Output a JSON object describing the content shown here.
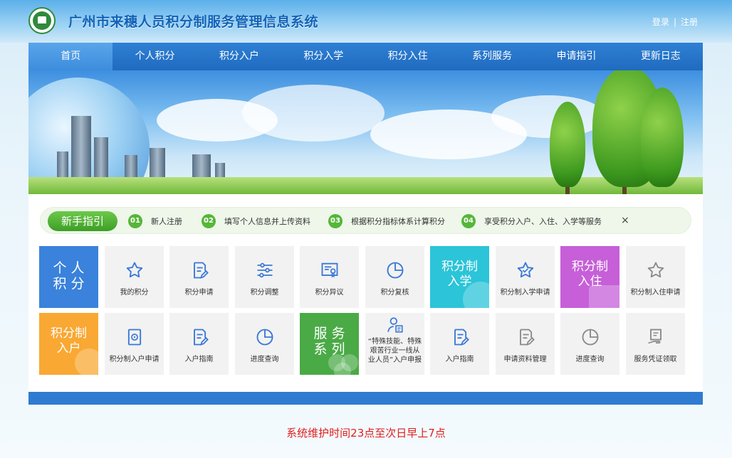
{
  "header": {
    "title": "广州市来穗人员积分制服务管理信息系统",
    "login": "登录",
    "separator": "|",
    "register": "注册"
  },
  "nav": [
    "首页",
    "个人积分",
    "积分入户",
    "积分入学",
    "积分入住",
    "系列服务",
    "申请指引",
    "更新日志"
  ],
  "guide": {
    "badge": "新手指引",
    "steps": [
      {
        "num": "01",
        "text": "新人注册"
      },
      {
        "num": "02",
        "text": "填写个人信息并上传资料"
      },
      {
        "num": "03",
        "text": "根据积分指标体系计算积分"
      },
      {
        "num": "04",
        "text": "享受积分入户、入住、入学等服务"
      }
    ],
    "close": "×"
  },
  "row1": {
    "category": {
      "line1": "个 人",
      "line2": "积 分",
      "color": "#3a82db"
    },
    "items": [
      {
        "icon": "star-icon",
        "label": "我的积分"
      },
      {
        "icon": "edit-document-icon",
        "label": "积分申请"
      },
      {
        "icon": "sliders-icon",
        "label": "积分调整"
      },
      {
        "icon": "certificate-icon",
        "label": "积分异议"
      },
      {
        "icon": "pie-chart-icon",
        "label": "积分复核"
      }
    ],
    "category2": {
      "line1": "积分制",
      "line2": "入学",
      "color": "#2bc4d8"
    },
    "item2": {
      "icon": "star-icon",
      "label": "积分制入学申请"
    },
    "category3": {
      "line1": "积分制",
      "line2": "入住",
      "color": "#c65fd8"
    },
    "item3": {
      "icon": "star-icon",
      "label": "积分制入住申请"
    }
  },
  "row2": {
    "category": {
      "line1": "积分制",
      "line2": "入户",
      "color": "#f9a833"
    },
    "items": [
      {
        "icon": "badge-icon",
        "label": "积分制入户申请"
      },
      {
        "icon": "edit-document-icon",
        "label": "入户指南"
      },
      {
        "icon": "pie-chart-icon",
        "label": "进度查询"
      }
    ],
    "category2": {
      "line1": "服 务",
      "line2": "系 列",
      "color": "#4aaa46"
    },
    "special": {
      "icon": "user-doc-icon",
      "line1": "“特殊技能、特殊",
      "line2": "艰苦行业一线从",
      "line3": "业人员”入户申报"
    },
    "items2": [
      {
        "icon": "edit-document-icon",
        "label": "入户指南"
      },
      {
        "icon": "edit-document-icon",
        "label": "申请资料管理"
      },
      {
        "icon": "pie-chart-icon",
        "label": "进度查询"
      },
      {
        "icon": "hand-document-icon",
        "label": "服务凭证领取"
      }
    ]
  },
  "notice": "系统维护时间23点至次日早上7点"
}
